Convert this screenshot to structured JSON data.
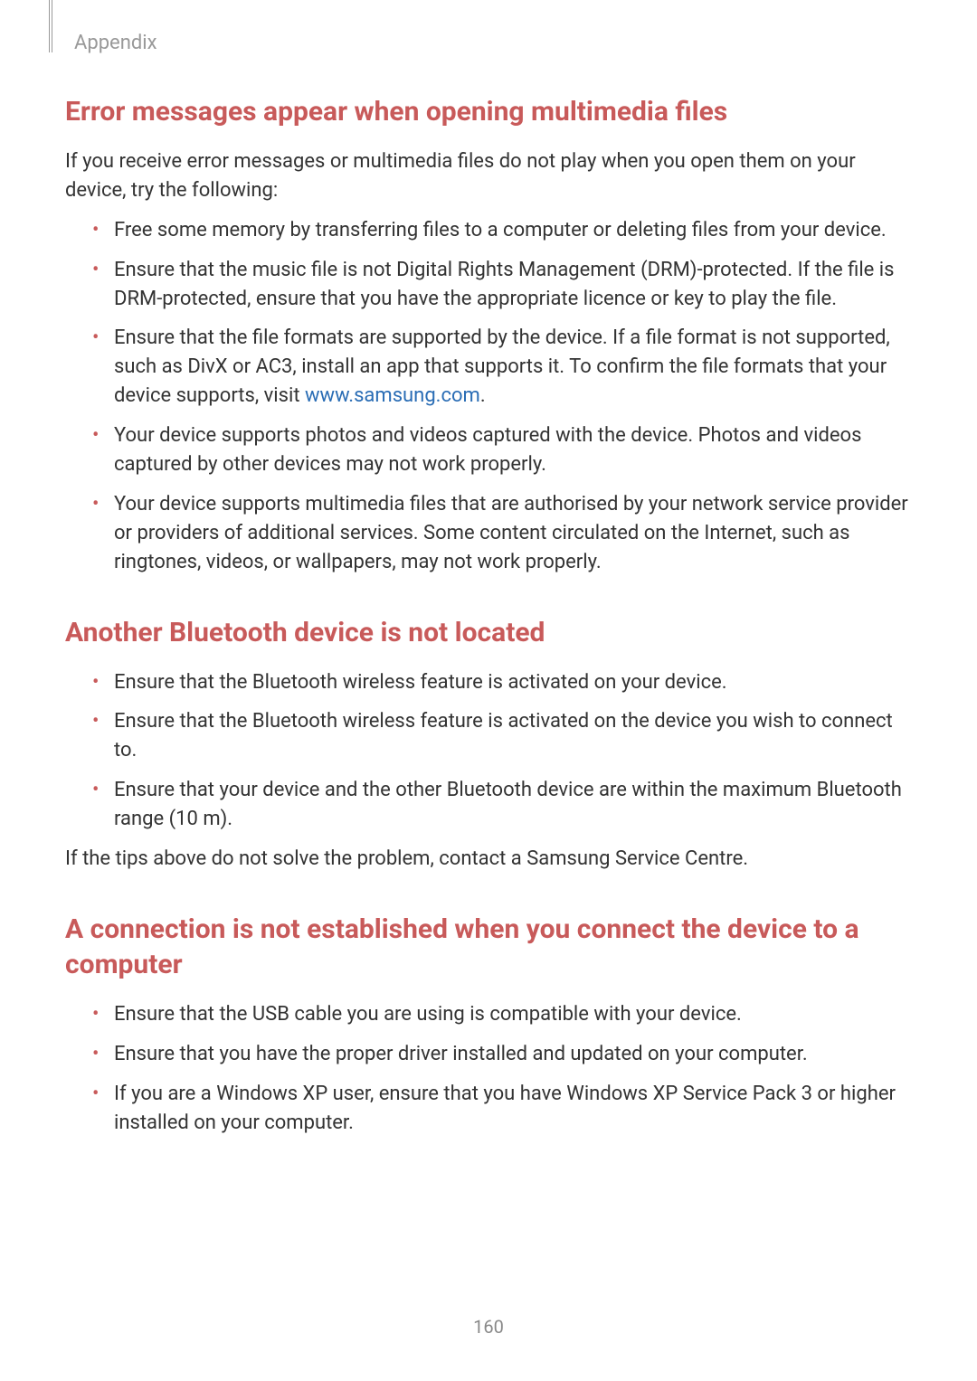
{
  "header": {
    "section": "Appendix"
  },
  "sections": [
    {
      "title": "Error messages appear when opening multimedia files",
      "intro": "If you receive error messages or multimedia files do not play when you open them on your device, try the following:",
      "items": [
        "Free some memory by transferring files to a computer or deleting files from your device.",
        "Ensure that the music file is not Digital Rights Management (DRM)-protected. If the file is DRM-protected, ensure that you have the appropriate licence or key to play the file.",
        "Ensure that the file formats are supported by the device. If a file format is not supported, such as DivX or AC3, install an app that supports it. To confirm the file formats that your device supports, visit ",
        "Your device supports photos and videos captured with the device. Photos and videos captured by other devices may not work properly.",
        "Your device supports multimedia files that are authorised by your network service provider or providers of additional services. Some content circulated on the Internet, such as ringtones, videos, or wallpapers, may not work properly."
      ],
      "link_text": "www.samsung.com",
      "link_after": "."
    },
    {
      "title": "Another Bluetooth device is not located",
      "items": [
        "Ensure that the Bluetooth wireless feature is activated on your device.",
        "Ensure that the Bluetooth wireless feature is activated on the device you wish to connect to.",
        "Ensure that your device and the other Bluetooth device are within the maximum Bluetooth range (10 m)."
      ],
      "outro": "If the tips above do not solve the problem, contact a Samsung Service Centre."
    },
    {
      "title": "A connection is not established when you connect the device to a computer",
      "items": [
        "Ensure that the USB cable you are using is compatible with your device.",
        "Ensure that you have the proper driver installed and updated on your computer.",
        "If you are a Windows XP user, ensure that you have Windows XP Service Pack 3 or higher installed on your computer."
      ]
    }
  ],
  "page_number": "160"
}
